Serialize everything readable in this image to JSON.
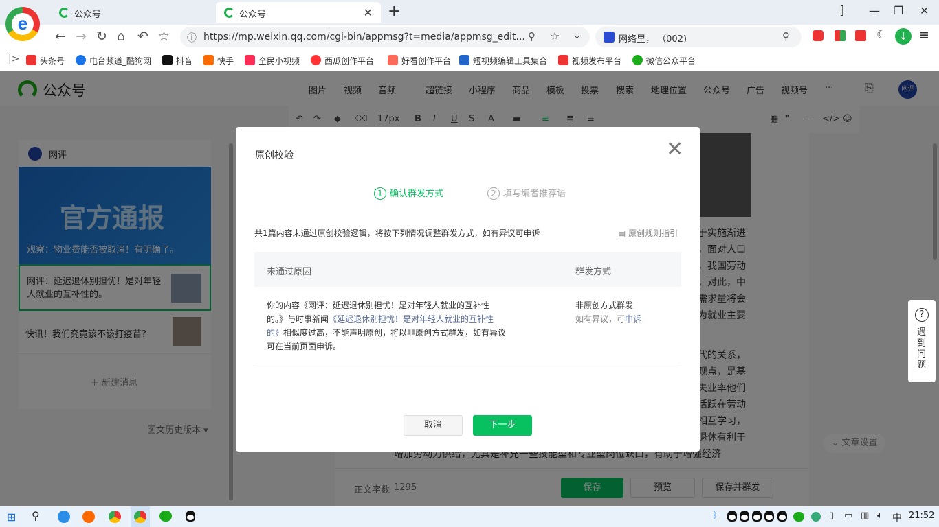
{
  "browser": {
    "tabs": [
      {
        "title": "公众号",
        "active": false
      },
      {
        "title": "公众号",
        "active": true
      }
    ],
    "url": "https://mp.weixin.qq.com/cgi-bin/appmsg?t=media/appmsg_edit...",
    "search_text": "网络里， （002)",
    "bookmarks": [
      {
        "label": "头条号",
        "color": "#e33"
      },
      {
        "label": "电台频道_酷狗网",
        "color": "#1a73e8"
      },
      {
        "label": "抖音",
        "color": "#111"
      },
      {
        "label": "快手",
        "color": "#ff6a00"
      },
      {
        "label": "全民小视频",
        "color": "#ff2d55"
      },
      {
        "label": "西瓜创作平台",
        "color": "#f33"
      },
      {
        "label": "好看创作平台",
        "color": "#ff6a5a"
      },
      {
        "label": "短视频编辑工具集合",
        "color": "#2266cc"
      },
      {
        "label": "视频发布平台",
        "color": "#e33"
      },
      {
        "label": "微信公众平台",
        "color": "#1aad19"
      }
    ]
  },
  "app": {
    "brand": "公众号",
    "nav": [
      "图片",
      "视频",
      "音频",
      "超链接",
      "小程序",
      "商品",
      "模板",
      "投票",
      "搜索",
      "地理位置",
      "公众号",
      "广告",
      "视频号",
      "···"
    ],
    "avatar_label": "网评",
    "font_size": "17px",
    "account_name": "网评",
    "cover_title": "官方通报",
    "cover_caption": "观察：物业费能否被取消！有明确了。",
    "articles": [
      {
        "title": "网评：延迟退休别担忧！是对年轻人就业的互补性的。"
      },
      {
        "title": "快讯！我们究竟该不该打疫苗?"
      }
    ],
    "new_message": "新建消息",
    "history": "图文历史版本",
    "body_lines_right": [
      "于实施渐进",
      "，面对人口",
      "，我国劳动",
      "。对此，中",
      "需求量将会",
      "为就业主要"
    ],
    "body_lines_right2": [
      "代的关系，",
      "观点，是基",
      "失业率他们",
      "活跃在劳动",
      "相互学习，",
      "退休有利于"
    ],
    "body_line_full": "增加劳动力供给，尤其是补充一些技能型和专业型岗位缺口，有助于增强经济",
    "word_count_label": "正文字数",
    "word_count": "1295",
    "save_label": "保存",
    "preview_label": "预览",
    "save_send_label": "保存并群发",
    "article_settings": "文章设置",
    "feedback": "遇到问题"
  },
  "modal": {
    "title": "原创校验",
    "steps": [
      {
        "num": "1",
        "label": "确认群发方式",
        "active": true
      },
      {
        "num": "2",
        "label": "填写编者推荐语",
        "active": false
      }
    ],
    "notice": "共1篇内容未通过原创校验逻辑，将按下列情况调整群发方式，如有异议可申诉",
    "rule_link": "原创规则指引",
    "col_reason": "未通过原因",
    "col_method": "群发方式",
    "reason_part1": "你的内容《网评：延迟退休别担忧！是对年轻人就业的互补性",
    "reason_part2": "的。》与时事新闻",
    "reason_link1": "《延迟退休别担忧！是对年轻人就业的互补性",
    "reason_link2": "的》",
    "reason_part3": "相似度过高，不能声明原创，将以非原创方式群发，如有异议",
    "reason_part4": "可在当前页面申诉。",
    "method": "非原创方式群发",
    "appeal_prefix": "如有异议，可",
    "appeal_link": "申诉",
    "cancel_label": "取消",
    "next_label": "下一步",
    "accent_color": "#07c160",
    "link_color": "#576b95"
  },
  "taskbar": {
    "ime": "中",
    "time": "21:52"
  }
}
